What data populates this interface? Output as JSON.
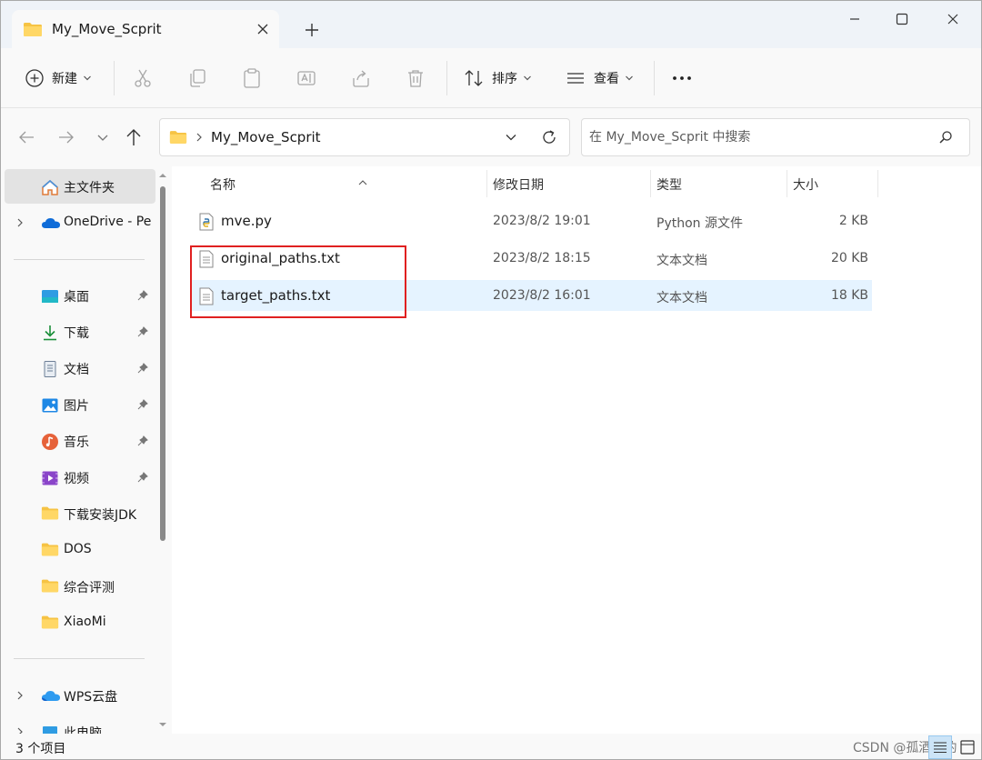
{
  "tab": {
    "title": "My_Move_Scprit"
  },
  "toolbar": {
    "new_label": "新建",
    "sort_label": "排序",
    "view_label": "查看"
  },
  "address": {
    "path": "My_Move_Scprit"
  },
  "search": {
    "placeholder": "在 My_Move_Scprit 中搜索"
  },
  "sidebar": {
    "items": [
      {
        "label": "主文件夹",
        "icon": "home-icon"
      },
      {
        "label": "OneDrive - Pe",
        "icon": "onedrive-icon"
      },
      {
        "label": "桌面",
        "icon": "desktop-icon",
        "pinned": true
      },
      {
        "label": "下载",
        "icon": "download-icon",
        "pinned": true
      },
      {
        "label": "文档",
        "icon": "document-icon",
        "pinned": true
      },
      {
        "label": "图片",
        "icon": "pictures-icon",
        "pinned": true
      },
      {
        "label": "音乐",
        "icon": "music-icon",
        "pinned": true
      },
      {
        "label": "视频",
        "icon": "video-icon",
        "pinned": true
      },
      {
        "label": "下载安装JDK",
        "icon": "folder-icon"
      },
      {
        "label": "DOS",
        "icon": "folder-icon"
      },
      {
        "label": "综合评测",
        "icon": "folder-icon"
      },
      {
        "label": "XiaoMi",
        "icon": "folder-icon"
      },
      {
        "label": "WPS云盘",
        "icon": "wps-cloud-icon"
      },
      {
        "label": "此电脑",
        "icon": "this-pc-icon"
      }
    ]
  },
  "columns": {
    "name": "名称",
    "modified": "修改日期",
    "type": "类型",
    "size": "大小"
  },
  "files": [
    {
      "name": "mve.py",
      "modified": "2023/8/2 19:01",
      "type": "Python 源文件",
      "size": "2 KB",
      "icon": "python-file-icon"
    },
    {
      "name": "original_paths.txt",
      "modified": "2023/8/2 18:15",
      "type": "文本文档",
      "size": "20 KB",
      "icon": "text-file-icon"
    },
    {
      "name": "target_paths.txt",
      "modified": "2023/8/2 16:01",
      "type": "文本文档",
      "size": "18 KB",
      "icon": "text-file-icon"
    }
  ],
  "status": {
    "count": "3 个项目"
  },
  "watermark": "CSDN @孤酒独酌",
  "colors": {
    "accent": "#0067c0",
    "selection": "#e5f3ff",
    "highlight_box": "#e02020",
    "folder": "#f6c344"
  }
}
